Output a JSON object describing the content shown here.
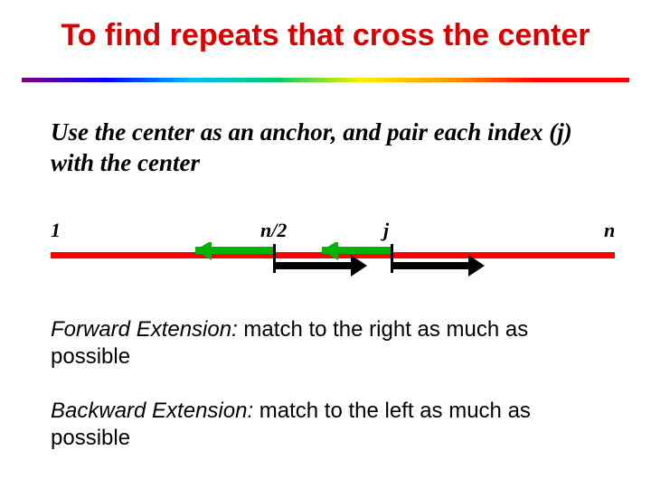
{
  "title": "To find repeats that cross the center",
  "subtitle": "Use the center as an anchor, and pair each index (j) with the center",
  "axis": {
    "one": "1",
    "half": "n/2",
    "j": "j",
    "n": "n"
  },
  "forward": {
    "label": "Forward Extension:",
    "rest": " match to the right as much as possible"
  },
  "backward": {
    "label": "Backward Extension:",
    "rest": " match to the left as much as possible"
  }
}
